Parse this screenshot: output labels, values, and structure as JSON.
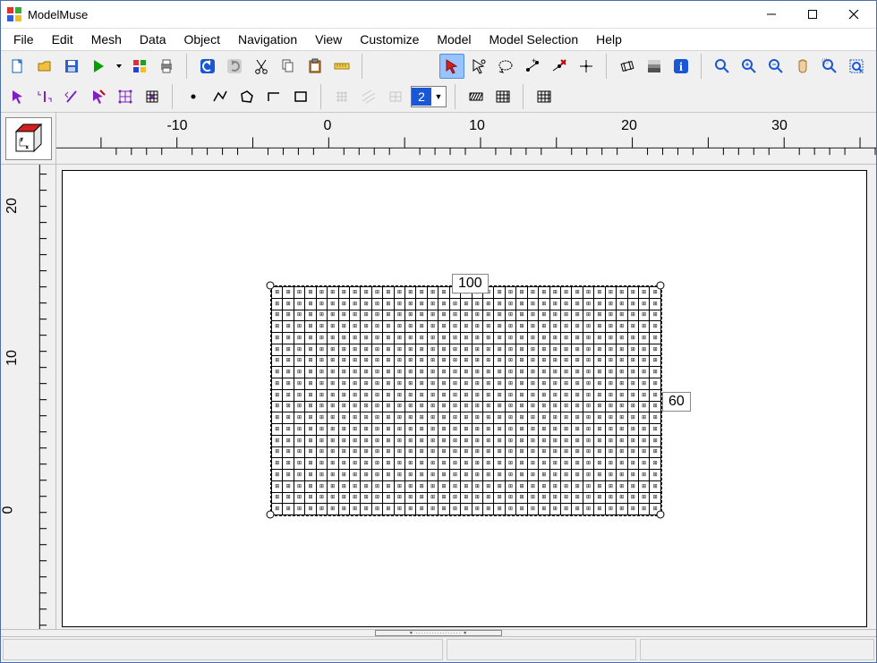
{
  "title": "ModelMuse",
  "menu": [
    "File",
    "Edit",
    "Mesh",
    "Data",
    "Object",
    "Navigation",
    "View",
    "Customize",
    "Model",
    "Model Selection",
    "Help"
  ],
  "toolbar1": {
    "new": "New",
    "open": "Open",
    "save": "Save",
    "run": "Run",
    "stop": "Stop",
    "visualize": "Visualize",
    "print": "Print",
    "undo": "Undo",
    "redo": "Redo",
    "cut": "Cut",
    "copy": "Copy",
    "paste": "Paste",
    "measure": "Measure",
    "select": "Select",
    "lasso": "Lasso",
    "selpoly": "Select polygon",
    "addv": "Add vertex",
    "delv": "Delete vertex",
    "move": "Move",
    "gridang": "Grid angle",
    "color": "Color legend",
    "info": "Info",
    "zoomfit": "Zoom extents",
    "zoomin": "Zoom in",
    "zoomout": "Zoom out",
    "pan": "Pan",
    "zoomw": "Zoom window",
    "zoomr": "Zoom region"
  },
  "toolbar2": {
    "objpoint": "Point",
    "objline": "Line",
    "objstr": "Straight line",
    "objpoly": "Polygon",
    "objcurve": "Curve",
    "objrect": "Rectangle",
    "gsmall": "Small grid",
    "gdiag": "Diag grid",
    "gsquare": "Square grid",
    "layer_value": "2",
    "viewhatch": "Hatch",
    "viewgrid": "Grid",
    "viewcells": "Cells"
  },
  "ruler_h": [
    {
      "v": "-10",
      "pos": 135
    },
    {
      "v": "0",
      "pos": 303
    },
    {
      "v": "10",
      "pos": 470
    },
    {
      "v": "20",
      "pos": 640
    },
    {
      "v": "30",
      "pos": 808
    }
  ],
  "ruler_v": [
    {
      "v": "20",
      "pos": 46
    },
    {
      "v": "10",
      "pos": 216
    },
    {
      "v": "0",
      "pos": 386
    }
  ],
  "callouts": {
    "top": "100",
    "right": "60"
  },
  "grid": {
    "rows": 20,
    "cols": 35
  }
}
